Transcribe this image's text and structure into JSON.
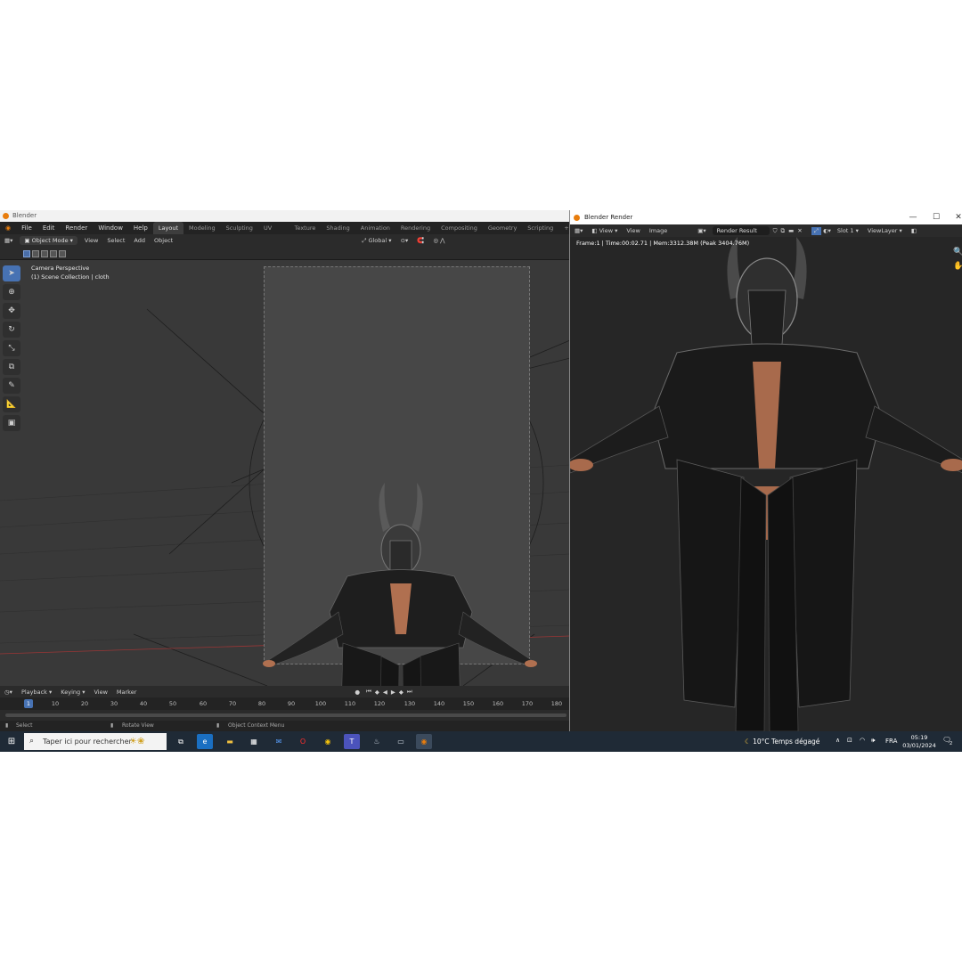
{
  "blender": {
    "window_title": "Blender",
    "menu": [
      "File",
      "Edit",
      "Render",
      "Window",
      "Help"
    ],
    "workspaces": [
      "Layout",
      "Modeling",
      "Sculpting",
      "UV Editing",
      "Texture Paint",
      "Shading",
      "Animation",
      "Rendering",
      "Compositing",
      "Geometry Nodes",
      "Scripting"
    ],
    "active_workspace": "Layout",
    "add_workspace": "+",
    "header": {
      "mode": "Object Mode",
      "menus": [
        "View",
        "Select",
        "Add",
        "Object"
      ],
      "orientation": "Global"
    },
    "viewport": {
      "info_line1": "Camera Perspective",
      "info_line2": "(1) Scene Collection | cloth"
    },
    "toolbar_icons": [
      "select-box-icon",
      "cursor-icon",
      "move-icon",
      "rotate-icon",
      "scale-icon",
      "transform-icon",
      "annotate-icon",
      "measure-icon",
      "add-cube-icon"
    ],
    "timeline": {
      "menus": [
        "Playback",
        "Keying",
        "View",
        "Marker"
      ],
      "current_frame": "1",
      "ticks": [
        "10",
        "20",
        "30",
        "40",
        "50",
        "60",
        "70",
        "80",
        "90",
        "100",
        "110",
        "120",
        "130",
        "140",
        "150",
        "160",
        "170",
        "180"
      ]
    },
    "statusbar": {
      "select": "Select",
      "rotate": "Rotate View",
      "context": "Object Context Menu"
    }
  },
  "render_window": {
    "title": "Blender Render",
    "menus": [
      "View",
      "View",
      "Image"
    ],
    "image_name": "Render Result",
    "slot": "Slot 1",
    "layer": "ViewLayer",
    "info": "Frame:1 | Time:00:02.71 | Mem:3312.38M (Peak 3404.76M)"
  },
  "taskbar": {
    "search_placeholder": "Taper ici pour rechercher",
    "weather": "10°C  Temps dégagé",
    "language": "FRA",
    "time": "05:19",
    "date": "03/01/2024",
    "notifications": "2"
  },
  "colors": {
    "blender_accent": "#4772b3",
    "blender_logo": "#e87d0d",
    "taskbar": "#1f2a36"
  }
}
